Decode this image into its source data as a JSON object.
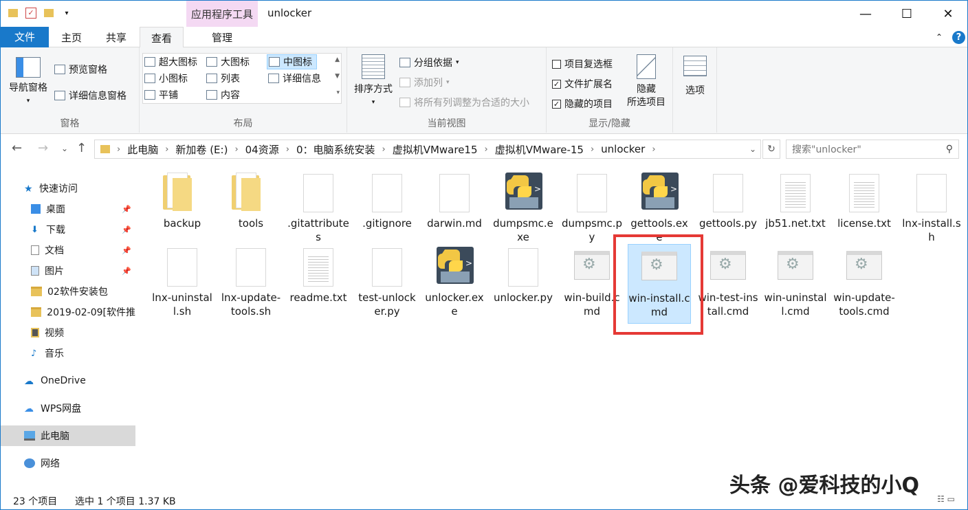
{
  "window": {
    "context_tab": "应用程序工具",
    "title": "unlocker",
    "min": "—",
    "max": "☐",
    "close": "✕"
  },
  "tabs": {
    "file": "文件",
    "home": "主页",
    "share": "共享",
    "view": "查看",
    "manage": "管理"
  },
  "ribbon": {
    "panes": {
      "nav_pane": "导航窗格",
      "preview_pane": "预览窗格",
      "details_pane": "详细信息窗格",
      "label": "窗格"
    },
    "layout": {
      "xl_icons": "超大图标",
      "large_icons": "大图标",
      "medium_icons": "中图标",
      "small_icons": "小图标",
      "list": "列表",
      "details": "详细信息",
      "tiles": "平铺",
      "content": "内容",
      "label": "布局"
    },
    "current_view": {
      "sort_by": "排序方式",
      "group_by": "分组依据",
      "add_columns": "添加列",
      "size_all": "将所有列调整为合适的大小",
      "label": "当前视图"
    },
    "show_hide": {
      "item_checkboxes": "项目复选框",
      "file_ext": "文件扩展名",
      "hidden_items": "隐藏的项目",
      "hide_selected_1": "隐藏",
      "hide_selected_2": "所选项目",
      "label": "显示/隐藏"
    },
    "options": "选项"
  },
  "address": {
    "crumbs": [
      "此电脑",
      "新加卷 (E:)",
      "04资源",
      "0：电脑系统安装",
      "虚拟机VMware15",
      "虚拟机VMware-15",
      "unlocker"
    ],
    "search_placeholder": "搜索\"unlocker\""
  },
  "nav": {
    "quick_access": "快速访问",
    "desktop": "桌面",
    "downloads": "下载",
    "documents": "文档",
    "pictures": "图片",
    "folder1": "02软件安装包",
    "folder2": "2019-02-09[软件推",
    "videos": "视频",
    "music": "音乐",
    "onedrive": "OneDrive",
    "wps": "WPS网盘",
    "this_pc": "此电脑",
    "network": "网络"
  },
  "files": {
    "f1": "backup",
    "f2": "tools",
    "f3": ".gitattributes",
    "f4": ".gitignore",
    "f5": "darwin.md",
    "f6": "dumpsmc.exe",
    "f7": "dumpsmc.py",
    "f8": "gettools.exe",
    "f9": "gettools.py",
    "f10": "jb51.net.txt",
    "f11": "license.txt",
    "f12": "lnx-install.sh",
    "f13": "lnx-uninstall.sh",
    "f14": "lnx-update-tools.sh",
    "f15": "readme.txt",
    "f16": "test-unlocker.py",
    "f17": "unlocker.exe",
    "f18": "unlocker.py",
    "f19": "win-build.cmd",
    "f20": "win-install.cmd",
    "f21": "win-test-install.cmd",
    "f22": "win-uninstall.cmd",
    "f23": "win-update-tools.cmd"
  },
  "status": {
    "count": "23 个项目",
    "selection": "选中 1 个项目  1.37 KB"
  },
  "watermark": "头条 @爱科技的小Q"
}
